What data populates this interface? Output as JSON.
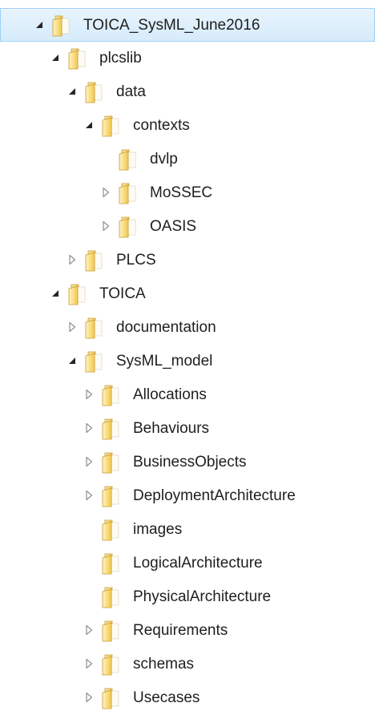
{
  "tree": {
    "items": [
      {
        "label": "TOICA_SysML_June2016",
        "level": 0,
        "state": "expanded",
        "selected": true
      },
      {
        "label": "plcslib",
        "level": 1,
        "state": "expanded"
      },
      {
        "label": "data",
        "level": 2,
        "state": "expanded"
      },
      {
        "label": "contexts",
        "level": 3,
        "state": "expanded"
      },
      {
        "label": "dvlp",
        "level": 4,
        "state": "leaf"
      },
      {
        "label": "MoSSEC",
        "level": 4,
        "state": "collapsed"
      },
      {
        "label": "OASIS",
        "level": 4,
        "state": "collapsed"
      },
      {
        "label": "PLCS",
        "level": 2,
        "state": "collapsed"
      },
      {
        "label": "TOICA",
        "level": 1,
        "state": "expanded"
      },
      {
        "label": "documentation",
        "level": 2,
        "state": "collapsed"
      },
      {
        "label": "SysML_model",
        "level": 2,
        "state": "expanded"
      },
      {
        "label": "Allocations",
        "level": 3,
        "state": "collapsed"
      },
      {
        "label": "Behaviours",
        "level": 3,
        "state": "collapsed"
      },
      {
        "label": "BusinessObjects",
        "level": 3,
        "state": "collapsed"
      },
      {
        "label": "DeploymentArchitecture",
        "level": 3,
        "state": "collapsed"
      },
      {
        "label": "images",
        "level": 3,
        "state": "leaf"
      },
      {
        "label": "LogicalArchitecture",
        "level": 3,
        "state": "leaf"
      },
      {
        "label": "PhysicalArchitecture",
        "level": 3,
        "state": "leaf"
      },
      {
        "label": "Requirements",
        "level": 3,
        "state": "collapsed"
      },
      {
        "label": "schemas",
        "level": 3,
        "state": "collapsed"
      },
      {
        "label": "Usecases",
        "level": 3,
        "state": "collapsed"
      }
    ]
  },
  "colors": {
    "selection_bg": "#d6ebfb",
    "selection_border": "#9fd0f7",
    "folder": "#f2c94c",
    "text": "#1e1e1e"
  },
  "icons": {
    "expanded": "tree-expanded-triangle-icon",
    "collapsed": "tree-collapsed-triangle-icon",
    "folder": "folder-icon"
  }
}
